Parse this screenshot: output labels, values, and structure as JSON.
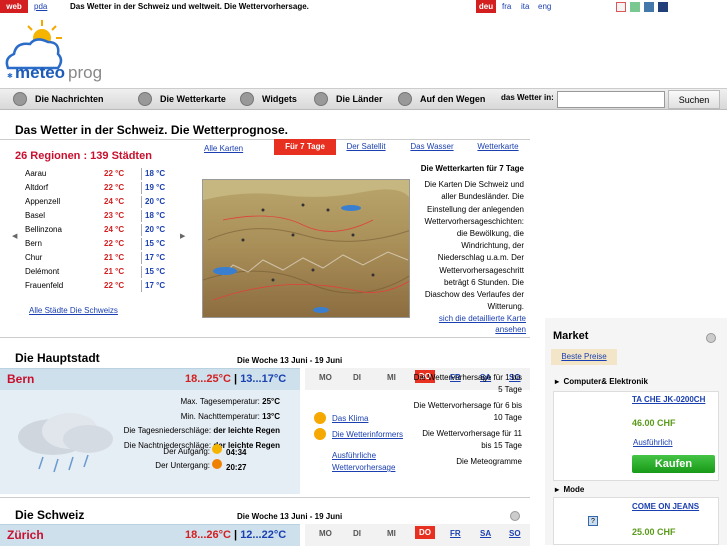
{
  "top": {
    "web": "web",
    "pda": "pda",
    "slogan": "Das Wetter in der Schweiz und weltweit. Die Wettervorhersage.",
    "lang_active": "deu",
    "langs": [
      "fra",
      "ita",
      "eng"
    ],
    "swatches": [
      "#f4f4f4",
      "#79c891",
      "#4477aa",
      "#223f7a"
    ]
  },
  "logo": {
    "text": "meteoprog"
  },
  "nav": {
    "items": [
      "Die Nachrichten",
      "Die Wetterkarte",
      "Widgets",
      "Die Länder",
      "Auf den Wegen"
    ],
    "search_label": "das Wetter in:",
    "search_placeholder": "",
    "search_button": "Suchen"
  },
  "main": {
    "title": "Das Wetter in der Schweiz. Die Wetterprognose."
  },
  "regions": {
    "title": "26 Regionen : 139 Städten",
    "cities": [
      {
        "name": "Aarau",
        "max": "22 °C",
        "min": "18 °C"
      },
      {
        "name": "Altdorf",
        "max": "22 °C",
        "min": "19 °C"
      },
      {
        "name": "Appenzell",
        "max": "24 °C",
        "min": "20 °C"
      },
      {
        "name": "Basel",
        "max": "23 °C",
        "min": "18 °C"
      },
      {
        "name": "Bellinzona",
        "max": "24 °C",
        "min": "20 °C"
      },
      {
        "name": "Bern",
        "max": "22 °C",
        "min": "15 °C"
      },
      {
        "name": "Chur",
        "max": "21 °C",
        "min": "17 °C"
      },
      {
        "name": "Delémont",
        "max": "21 °C",
        "min": "15 °C"
      },
      {
        "name": "Frauenfeld",
        "max": "22 °C",
        "min": "17 °C"
      }
    ],
    "all_cities": "Alle Städte Die Schweizs"
  },
  "maptabs": {
    "all_maps": "Alle Karten",
    "tabs": [
      "Für 7 Tage",
      "Der Satellit",
      "Das Wasser",
      "Wetterkarte"
    ]
  },
  "map": {
    "desc_title": "Die Wetterkarten für 7 Tage",
    "desc": "Die Karten Die Schweiz und aller Bundesländer. Die Einstellung der anlegenden Wettervorhersageschichten: die Bewölkung, die Windrichtung, der Niederschlag u.a.m. Der Wettervorhersageschritt beträgt 6 Stunden. Die Diaschow des Verlaufes der Witterung.",
    "detail_link": "sich die detaillierte Karte ansehen"
  },
  "capital": {
    "title": "Die Hauptstadt",
    "week": "Die Woche 13 Juni - 19 Juni",
    "city": "Bern",
    "temp_max": "18...25°C",
    "temp_sep": "|",
    "temp_min": "13...17°C",
    "days": [
      "MO",
      "DI",
      "MI",
      "DO",
      "FR",
      "SA",
      "SO"
    ],
    "details": [
      {
        "label": "Max. Tagesemperatur:",
        "value": "25°C"
      },
      {
        "label": "Min. Nachttemperatur:",
        "value": "13°C"
      },
      {
        "label": "Die Tagesniederschläge:",
        "value": "der leichte Regen"
      },
      {
        "label": "Die Nachtniederschläge:",
        "value": "der leichte Regen"
      }
    ],
    "sunrise_label": "Der Aufgang:",
    "sunrise": "04:34",
    "sunset_label": "Der Untergang:",
    "sunset": "20:27",
    "links": [
      "Das Klima",
      "Die Wetterinformers",
      "Ausführliche Wettervorhersage"
    ],
    "forecast": [
      "Die Wettervorhersage für 1 bis 5 Tage",
      "Die Wettervorhersage für 6 bis 10 Tage",
      "Die Wettervorhersage für 11 bis 15 Tage",
      "Die Meteogramme"
    ]
  },
  "schweiz": {
    "title": "Die Schweiz",
    "week": "Die Woche 13 Juni - 19 Juni",
    "city": "Zürich",
    "temp_max": "18...26°C",
    "temp_sep": "|",
    "temp_min": "12...22°C"
  },
  "market": {
    "title": "Market",
    "tab": "Beste Preise",
    "categories": [
      "Computer& Elektronik",
      "Mode"
    ],
    "products": [
      {
        "name": "TA CHE JK-0200CH",
        "price": "46.00 CHF",
        "more": "Ausführlich",
        "buy": "Kaufen"
      },
      {
        "name": "COME ON JEANS",
        "price": "25.00 CHF"
      }
    ]
  }
}
